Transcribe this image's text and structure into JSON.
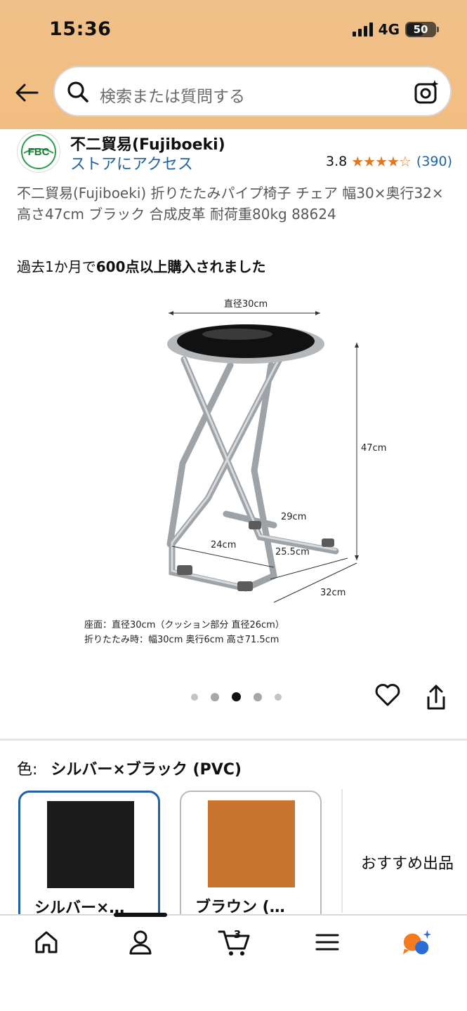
{
  "status": {
    "time": "15:36",
    "network": "4G",
    "battery": "50"
  },
  "search": {
    "placeholder": "検索または質問する"
  },
  "brand": {
    "name": "不二貿易(Fujiboeki)",
    "store_link": "ストアにアクセス",
    "logo_text": "FBC",
    "rating": "3.8",
    "stars": "★★★★☆",
    "review_count": "(390)"
  },
  "product": {
    "title": "不二貿易(Fujiboeki) 折りたたみパイプ椅子 チェア 幅30×奥行32×高さ47cm ブラック 合成皮革 耐荷重80kg 88624",
    "purchase_prefix": "過去1か月で",
    "purchase_bold": "600点以上購入されました"
  },
  "image": {
    "dim_width_top": "直径30cm",
    "dim_height": "47cm",
    "dim_inner_depth": "29cm",
    "dim_base_width": "24cm",
    "dim_foot": "25.5cm",
    "dim_depth": "32cm",
    "note_line1": "座面：直径30cm（クッション部分 直径26cm）",
    "note_line2": "折りたたみ時：幅30cm 奥行6cm 高さ71.5cm"
  },
  "carousel": {
    "count": 5,
    "active_index": 2
  },
  "color_selector": {
    "label": "色:",
    "selected": "シルバー×ブラック (PVC)",
    "variants": [
      {
        "label": "シルバー×…",
        "swatch": "#1c1c1c"
      },
      {
        "label": "ブラウン (…",
        "swatch": "#c8742e"
      }
    ],
    "recommend": "おすすめ出品"
  },
  "nav": {
    "cart_count": "3",
    "items": [
      "home-icon",
      "account-icon",
      "cart-icon",
      "menu-icon",
      "rufus-icon"
    ]
  },
  "colors": {
    "header": "#f2bd80",
    "link": "#2162a1",
    "star": "#de7921",
    "selected_border": "#2162a1"
  }
}
